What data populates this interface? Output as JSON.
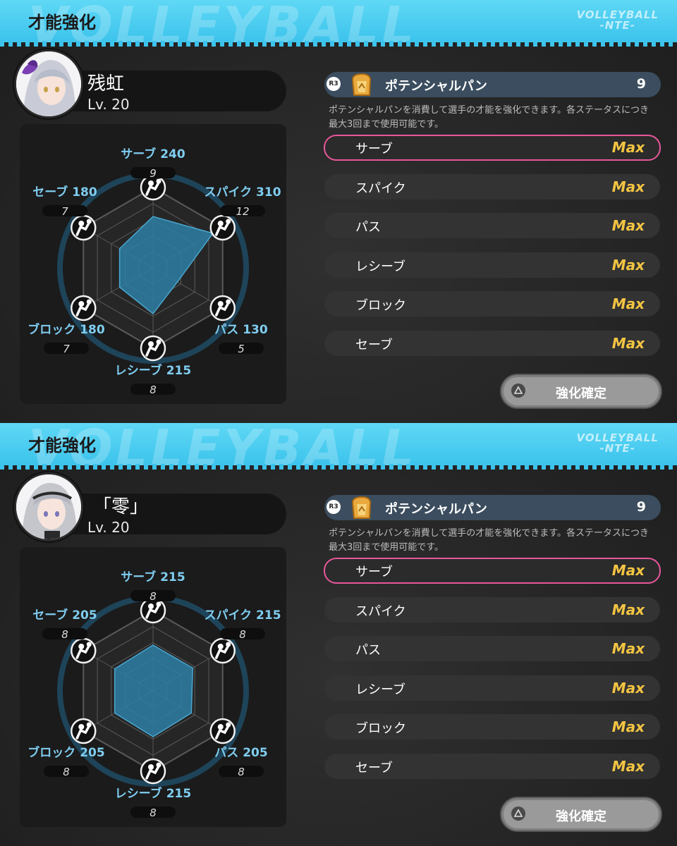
{
  "panels": [
    {
      "title": "才能強化",
      "watermark": "VOLLEYBALL",
      "brand": [
        "VOLLEYBALL",
        "-NTE-"
      ],
      "character": {
        "name": "残虹",
        "level": "Lv. 20",
        "portrait": "silver-haired-girl-with-purple-flower"
      },
      "stats": [
        {
          "label": "サーブ 240",
          "value": "9",
          "icon": "serve-icon",
          "level": 0.64
        },
        {
          "label": "スパイク 310",
          "value": "12",
          "icon": "spike-icon",
          "level": 0.86
        },
        {
          "label": "パス 130",
          "value": "5",
          "icon": "pass-icon",
          "level": 0.35
        },
        {
          "label": "レシーブ 215",
          "value": "8",
          "icon": "receive-icon",
          "level": 0.57
        },
        {
          "label": "ブロック 180",
          "value": "7",
          "icon": "block-icon",
          "level": 0.48
        },
        {
          "label": "セーブ 180",
          "value": "7",
          "icon": "save-icon",
          "level": 0.48
        }
      ],
      "item": {
        "button_hint": "R3",
        "name": "ポテンシャルパン",
        "count": "9",
        "icon": "bread-icon"
      },
      "description": "ポテンシャルパンを消費して選手の才能を強化できます。各ステータスにつき最大3回まで使用可能です。",
      "rows": [
        {
          "label": "サーブ",
          "status": "Max"
        },
        {
          "label": "スパイク",
          "status": "Max"
        },
        {
          "label": "パス",
          "status": "Max"
        },
        {
          "label": "レシーブ",
          "status": "Max"
        },
        {
          "label": "ブロック",
          "status": "Max"
        },
        {
          "label": "セーブ",
          "status": "Max"
        }
      ],
      "confirm": "強化確定",
      "colors": {
        "accent": "#3cc3ec",
        "radar_fill": "#2e7fa5",
        "max": "#f4c542",
        "selected": "#e8579a"
      }
    },
    {
      "title": "才能強化",
      "watermark": "VOLLEYBALL",
      "brand": [
        "VOLLEYBALL",
        "-NTE-"
      ],
      "character": {
        "name": "「零」",
        "level": "Lv. 20",
        "portrait": "silver-haired-girl-with-headband"
      },
      "stats": [
        {
          "label": "サーブ 215",
          "value": "8",
          "icon": "serve-icon",
          "level": 0.57
        },
        {
          "label": "スパイク 215",
          "value": "8",
          "icon": "spike-icon",
          "level": 0.57
        },
        {
          "label": "パス 205",
          "value": "8",
          "icon": "pass-icon",
          "level": 0.55
        },
        {
          "label": "レシーブ 215",
          "value": "8",
          "icon": "receive-icon",
          "level": 0.57
        },
        {
          "label": "ブロック 205",
          "value": "8",
          "icon": "block-icon",
          "level": 0.55
        },
        {
          "label": "セーブ 205",
          "value": "8",
          "icon": "save-icon",
          "level": 0.55
        }
      ],
      "item": {
        "button_hint": "R3",
        "name": "ポテンシャルパン",
        "count": "9",
        "icon": "bread-icon"
      },
      "description": "ポテンシャルパンを消費して選手の才能を強化できます。各ステータスにつき最大3回まで使用可能です。",
      "rows": [
        {
          "label": "サーブ",
          "status": "Max"
        },
        {
          "label": "スパイク",
          "status": "Max"
        },
        {
          "label": "パス",
          "status": "Max"
        },
        {
          "label": "レシーブ",
          "status": "Max"
        },
        {
          "label": "ブロック",
          "status": "Max"
        },
        {
          "label": "セーブ",
          "status": "Max"
        }
      ],
      "confirm": "強化確定",
      "colors": {
        "accent": "#3cc3ec",
        "radar_fill": "#2e7fa5",
        "max": "#f4c542",
        "selected": "#e8579a"
      }
    }
  ]
}
